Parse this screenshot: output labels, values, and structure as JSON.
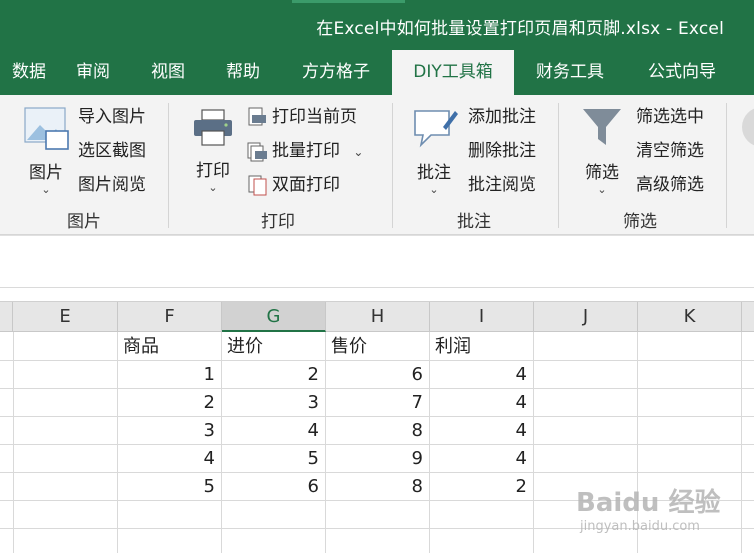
{
  "window": {
    "title": "在Excel中如何批量设置打印页眉和页脚.xlsx  -  Excel"
  },
  "tabs": [
    {
      "label": "数据"
    },
    {
      "label": "审阅"
    },
    {
      "label": "视图"
    },
    {
      "label": "帮助"
    },
    {
      "label": "方方格子"
    },
    {
      "label": "DIY工具箱",
      "active": true
    },
    {
      "label": "财务工具"
    },
    {
      "label": "公式向导"
    }
  ],
  "ribbon": {
    "picture": {
      "big_label": "图片",
      "items": [
        "导入图片",
        "选区截图",
        "图片阅览"
      ],
      "group_label": "图片"
    },
    "print": {
      "big_label": "打印",
      "items": [
        "打印当前页",
        "批量打印",
        "双面打印"
      ],
      "group_label": "打印"
    },
    "comment": {
      "big_label": "批注",
      "items": [
        "添加批注",
        "删除批注",
        "批注阅览"
      ],
      "group_label": "批注"
    },
    "filter": {
      "big_label": "筛选",
      "items": [
        "筛选选中",
        "清空筛选",
        "高级筛选"
      ],
      "group_label": "筛选"
    }
  },
  "sheet": {
    "columns": [
      "E",
      "F",
      "G",
      "H",
      "I",
      "J",
      "K"
    ],
    "selected_column": "G",
    "headers": [
      "商品",
      "进价",
      "售价",
      "利润"
    ],
    "rows": [
      [
        "1",
        "2",
        "6",
        "4"
      ],
      [
        "2",
        "3",
        "7",
        "4"
      ],
      [
        "3",
        "4",
        "8",
        "4"
      ],
      [
        "4",
        "5",
        "9",
        "4"
      ],
      [
        "5",
        "6",
        "8",
        "2"
      ]
    ]
  },
  "watermark": {
    "logo": "Baidu 经验",
    "url": "jingyan.baidu.com"
  },
  "colors": {
    "excel_green": "#217346",
    "ribbon_bg": "#f3f3f3",
    "header_bg": "#e6e6e6"
  }
}
